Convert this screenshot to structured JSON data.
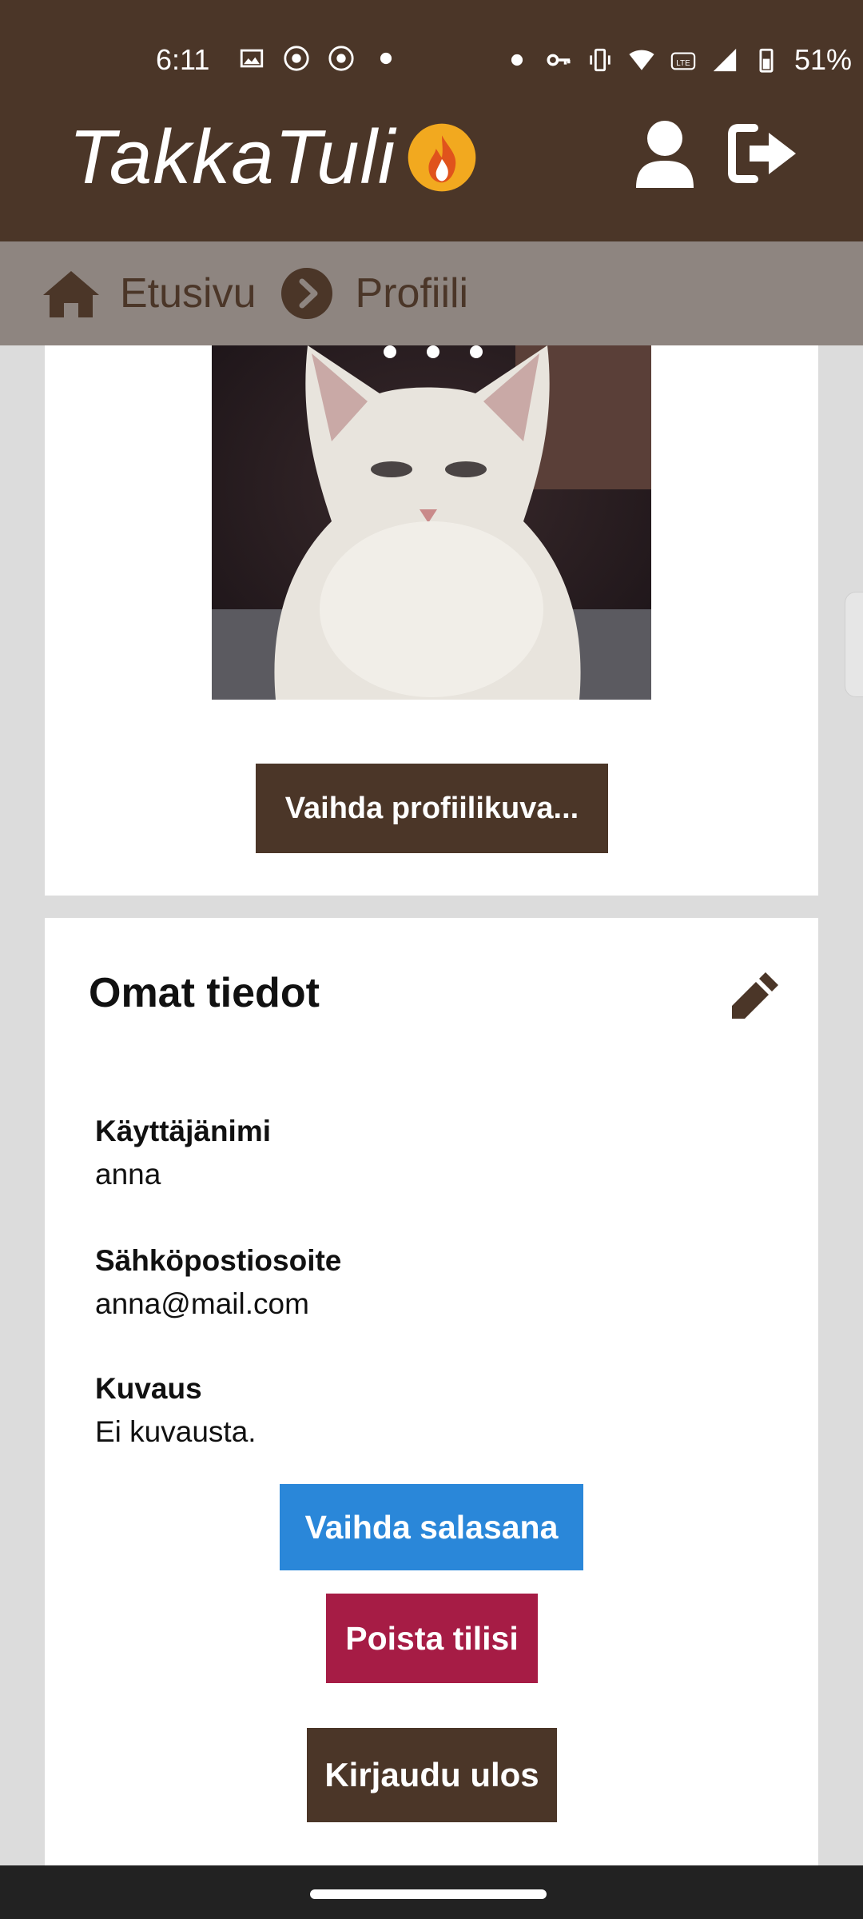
{
  "status_bar": {
    "time": "6:11",
    "battery": "51%",
    "icons": [
      "image-icon",
      "app-icon",
      "app-icon",
      "dot-icon",
      "dot-icon",
      "key-icon",
      "vibrate-icon",
      "wifi-icon",
      "volte-icon",
      "signal-icon",
      "battery-icon"
    ]
  },
  "header": {
    "logo_text": "TakkaTuli",
    "icons": [
      "user-icon",
      "logout-icon"
    ]
  },
  "breadcrumb": {
    "home": "Etusivu",
    "current": "Profiili"
  },
  "profile_card": {
    "change_picture_label": "Vaihda profiilikuva..."
  },
  "info_card": {
    "title": "Omat tiedot",
    "fields": [
      {
        "label": "Käyttäjänimi",
        "value": "anna"
      },
      {
        "label": "Sähköpostiosoite",
        "value": "anna@mail.com"
      },
      {
        "label": "Kuvaus",
        "value": "Ei kuvausta."
      }
    ],
    "change_password_label": "Vaihda salasana",
    "delete_account_label": "Poista tilisi",
    "logout_label": "Kirjaudu ulos"
  },
  "colors": {
    "brand_brown": "#4b3628",
    "breadcrumb_bg": "#8e8580",
    "primary_blue": "#2a87d9",
    "danger_red": "#a61c45",
    "flame_orange": "#f2a91f"
  }
}
